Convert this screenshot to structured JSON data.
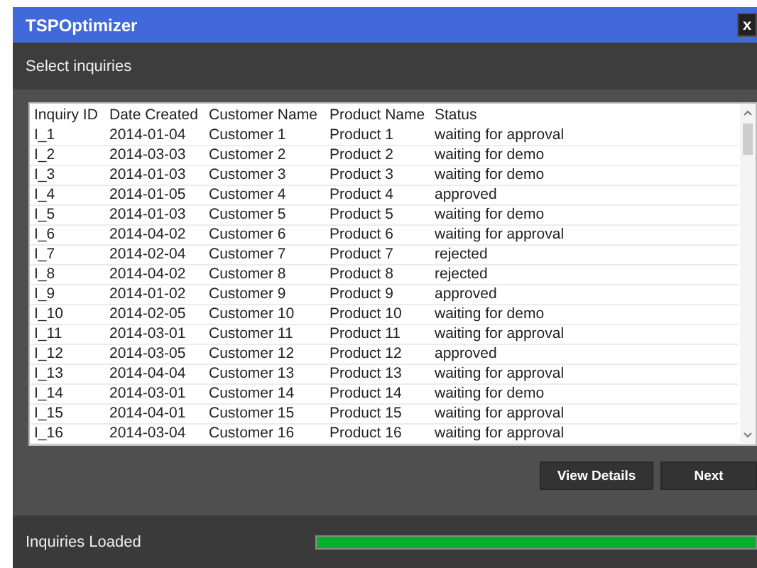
{
  "window": {
    "title": "TSPOptimizer",
    "close": "x"
  },
  "header": "Select inquiries",
  "table": {
    "columns": [
      "Inquiry ID",
      "Date Created",
      "Customer Name",
      "Product Name",
      "Status"
    ],
    "rows": [
      [
        "I_1",
        "2014-01-04",
        "Customer 1",
        "Product 1",
        "waiting for approval"
      ],
      [
        "I_2",
        "2014-03-03",
        "Customer 2",
        "Product 2",
        "waiting for demo"
      ],
      [
        "I_3",
        "2014-01-03",
        "Customer 3",
        "Product 3",
        "waiting for demo"
      ],
      [
        "I_4",
        "2014-01-05",
        "Customer 4",
        "Product 4",
        "approved"
      ],
      [
        "I_5",
        "2014-01-03",
        "Customer 5",
        "Product 5",
        "waiting for demo"
      ],
      [
        "I_6",
        "2014-04-02",
        "Customer 6",
        "Product 6",
        "waiting for approval"
      ],
      [
        "I_7",
        "2014-02-04",
        "Customer 7",
        "Product 7",
        "rejected"
      ],
      [
        "I_8",
        "2014-04-02",
        "Customer 8",
        "Product 8",
        "rejected"
      ],
      [
        "I_9",
        "2014-01-02",
        "Customer 9",
        "Product 9",
        "approved"
      ],
      [
        "I_10",
        "2014-02-05",
        "Customer 10",
        "Product 10",
        "waiting for demo"
      ],
      [
        "I_11",
        "2014-03-01",
        "Customer 11",
        "Product 11",
        "waiting for approval"
      ],
      [
        "I_12",
        "2014-03-05",
        "Customer 12",
        "Product 12",
        "approved"
      ],
      [
        "I_13",
        "2014-04-04",
        "Customer 13",
        "Product 13",
        "waiting for approval"
      ],
      [
        "I_14",
        "2014-03-01",
        "Customer 14",
        "Product 14",
        "waiting for demo"
      ],
      [
        "I_15",
        "2014-04-01",
        "Customer 15",
        "Product 15",
        "waiting for approval"
      ],
      [
        "I_16",
        "2014-03-04",
        "Customer 16",
        "Product 16",
        "waiting for approval"
      ]
    ]
  },
  "buttons": [
    "View Details",
    "Next"
  ],
  "status": {
    "label": "Inquiries Loaded",
    "level": 1
  }
}
